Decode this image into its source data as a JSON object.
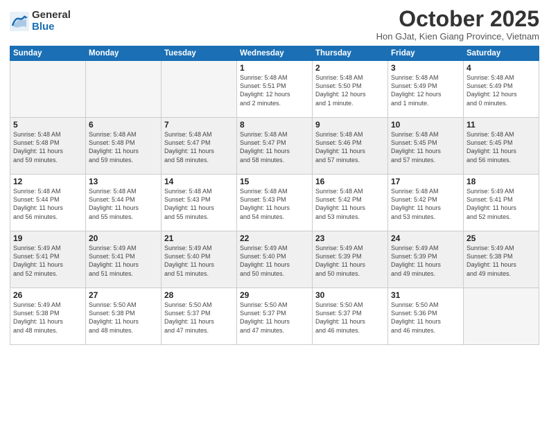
{
  "logo": {
    "general": "General",
    "blue": "Blue"
  },
  "title": "October 2025",
  "location": "Hon GJat, Kien Giang Province, Vietnam",
  "weekdays": [
    "Sunday",
    "Monday",
    "Tuesday",
    "Wednesday",
    "Thursday",
    "Friday",
    "Saturday"
  ],
  "weeks": [
    [
      {
        "day": "",
        "info": ""
      },
      {
        "day": "",
        "info": ""
      },
      {
        "day": "",
        "info": ""
      },
      {
        "day": "1",
        "info": "Sunrise: 5:48 AM\nSunset: 5:51 PM\nDaylight: 12 hours\nand 2 minutes."
      },
      {
        "day": "2",
        "info": "Sunrise: 5:48 AM\nSunset: 5:50 PM\nDaylight: 12 hours\nand 1 minute."
      },
      {
        "day": "3",
        "info": "Sunrise: 5:48 AM\nSunset: 5:49 PM\nDaylight: 12 hours\nand 1 minute."
      },
      {
        "day": "4",
        "info": "Sunrise: 5:48 AM\nSunset: 5:49 PM\nDaylight: 12 hours\nand 0 minutes."
      }
    ],
    [
      {
        "day": "5",
        "info": "Sunrise: 5:48 AM\nSunset: 5:48 PM\nDaylight: 11 hours\nand 59 minutes."
      },
      {
        "day": "6",
        "info": "Sunrise: 5:48 AM\nSunset: 5:48 PM\nDaylight: 11 hours\nand 59 minutes."
      },
      {
        "day": "7",
        "info": "Sunrise: 5:48 AM\nSunset: 5:47 PM\nDaylight: 11 hours\nand 58 minutes."
      },
      {
        "day": "8",
        "info": "Sunrise: 5:48 AM\nSunset: 5:47 PM\nDaylight: 11 hours\nand 58 minutes."
      },
      {
        "day": "9",
        "info": "Sunrise: 5:48 AM\nSunset: 5:46 PM\nDaylight: 11 hours\nand 57 minutes."
      },
      {
        "day": "10",
        "info": "Sunrise: 5:48 AM\nSunset: 5:45 PM\nDaylight: 11 hours\nand 57 minutes."
      },
      {
        "day": "11",
        "info": "Sunrise: 5:48 AM\nSunset: 5:45 PM\nDaylight: 11 hours\nand 56 minutes."
      }
    ],
    [
      {
        "day": "12",
        "info": "Sunrise: 5:48 AM\nSunset: 5:44 PM\nDaylight: 11 hours\nand 56 minutes."
      },
      {
        "day": "13",
        "info": "Sunrise: 5:48 AM\nSunset: 5:44 PM\nDaylight: 11 hours\nand 55 minutes."
      },
      {
        "day": "14",
        "info": "Sunrise: 5:48 AM\nSunset: 5:43 PM\nDaylight: 11 hours\nand 55 minutes."
      },
      {
        "day": "15",
        "info": "Sunrise: 5:48 AM\nSunset: 5:43 PM\nDaylight: 11 hours\nand 54 minutes."
      },
      {
        "day": "16",
        "info": "Sunrise: 5:48 AM\nSunset: 5:42 PM\nDaylight: 11 hours\nand 53 minutes."
      },
      {
        "day": "17",
        "info": "Sunrise: 5:48 AM\nSunset: 5:42 PM\nDaylight: 11 hours\nand 53 minutes."
      },
      {
        "day": "18",
        "info": "Sunrise: 5:49 AM\nSunset: 5:41 PM\nDaylight: 11 hours\nand 52 minutes."
      }
    ],
    [
      {
        "day": "19",
        "info": "Sunrise: 5:49 AM\nSunset: 5:41 PM\nDaylight: 11 hours\nand 52 minutes."
      },
      {
        "day": "20",
        "info": "Sunrise: 5:49 AM\nSunset: 5:41 PM\nDaylight: 11 hours\nand 51 minutes."
      },
      {
        "day": "21",
        "info": "Sunrise: 5:49 AM\nSunset: 5:40 PM\nDaylight: 11 hours\nand 51 minutes."
      },
      {
        "day": "22",
        "info": "Sunrise: 5:49 AM\nSunset: 5:40 PM\nDaylight: 11 hours\nand 50 minutes."
      },
      {
        "day": "23",
        "info": "Sunrise: 5:49 AM\nSunset: 5:39 PM\nDaylight: 11 hours\nand 50 minutes."
      },
      {
        "day": "24",
        "info": "Sunrise: 5:49 AM\nSunset: 5:39 PM\nDaylight: 11 hours\nand 49 minutes."
      },
      {
        "day": "25",
        "info": "Sunrise: 5:49 AM\nSunset: 5:38 PM\nDaylight: 11 hours\nand 49 minutes."
      }
    ],
    [
      {
        "day": "26",
        "info": "Sunrise: 5:49 AM\nSunset: 5:38 PM\nDaylight: 11 hours\nand 48 minutes."
      },
      {
        "day": "27",
        "info": "Sunrise: 5:50 AM\nSunset: 5:38 PM\nDaylight: 11 hours\nand 48 minutes."
      },
      {
        "day": "28",
        "info": "Sunrise: 5:50 AM\nSunset: 5:37 PM\nDaylight: 11 hours\nand 47 minutes."
      },
      {
        "day": "29",
        "info": "Sunrise: 5:50 AM\nSunset: 5:37 PM\nDaylight: 11 hours\nand 47 minutes."
      },
      {
        "day": "30",
        "info": "Sunrise: 5:50 AM\nSunset: 5:37 PM\nDaylight: 11 hours\nand 46 minutes."
      },
      {
        "day": "31",
        "info": "Sunrise: 5:50 AM\nSunset: 5:36 PM\nDaylight: 11 hours\nand 46 minutes."
      },
      {
        "day": "",
        "info": ""
      }
    ]
  ]
}
